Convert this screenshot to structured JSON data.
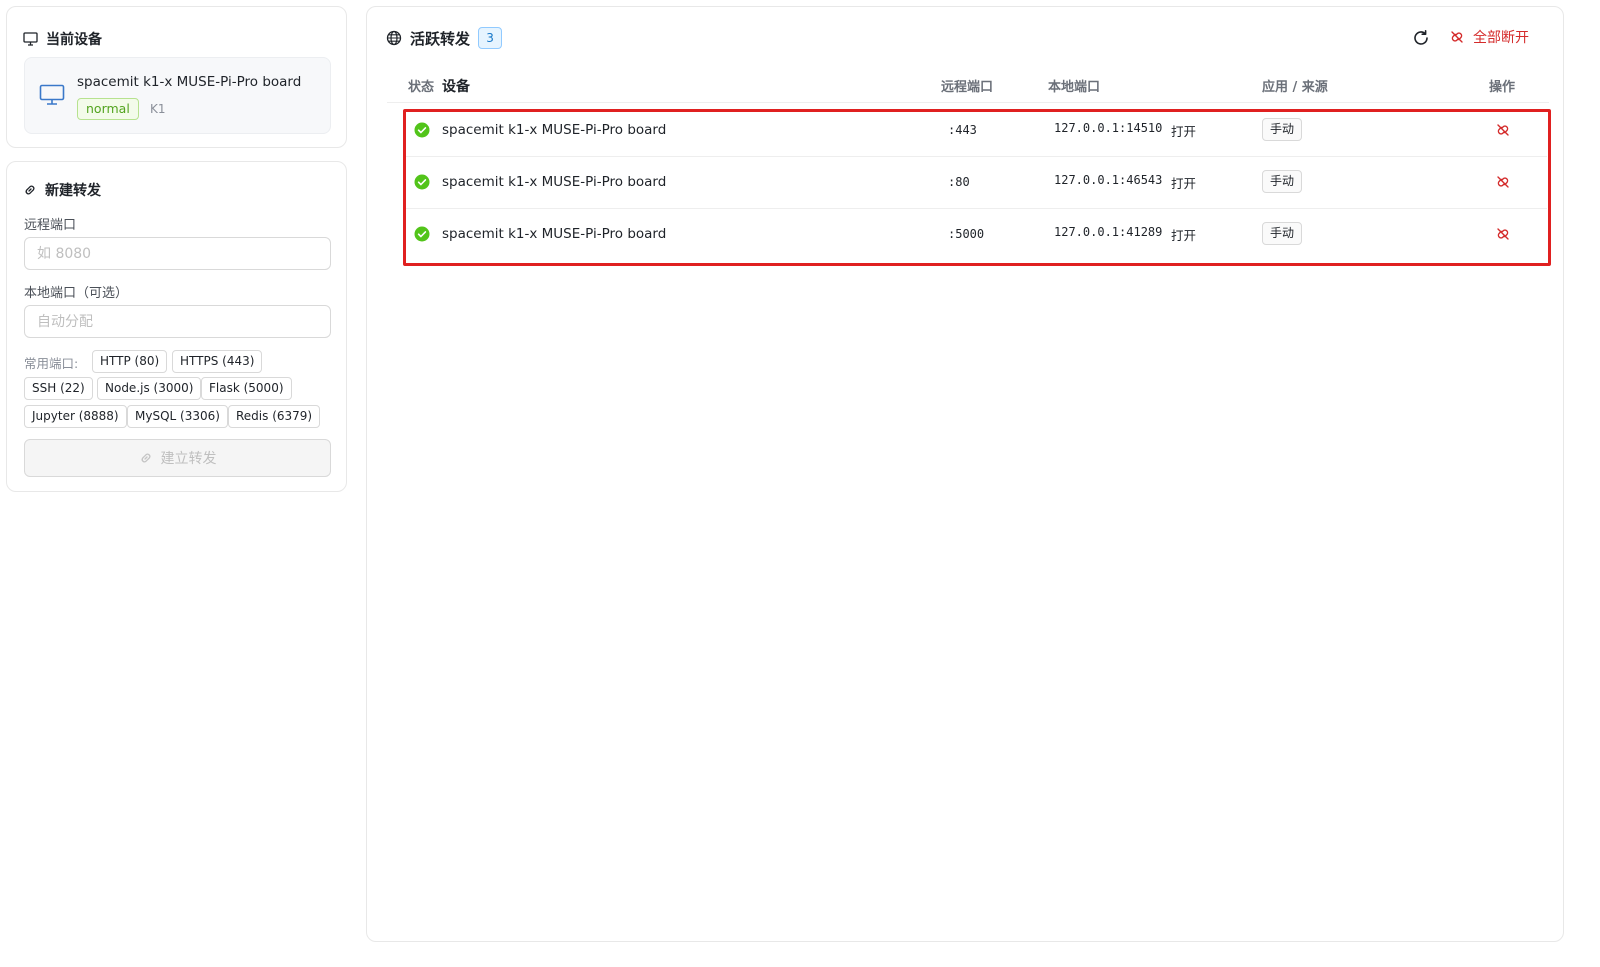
{
  "current_device": {
    "title": "当前设备",
    "icon": "monitor-icon",
    "name": "spacemit k1-x MUSE-Pi-Pro board",
    "status": "normal",
    "model": "K1"
  },
  "new_forward": {
    "title": "新建转发",
    "icon": "link-icon",
    "remote_port": {
      "label": "远程端口",
      "placeholder": "如 8080",
      "value": ""
    },
    "local_port": {
      "label": "本地端口（可选）",
      "placeholder": "自动分配",
      "value": ""
    },
    "common_ports_label": "常用端口:",
    "common_ports": [
      "HTTP (80)",
      "HTTPS (443)",
      "SSH (22)",
      "Node.js (3000)",
      "Flask (5000)",
      "Jupyter (8888)",
      "MySQL (3306)",
      "Redis (6379)"
    ],
    "submit_label": "建立转发"
  },
  "active_forwards": {
    "title": "活跃转发",
    "icon": "globe-icon",
    "count": "3",
    "disconnect_all_label": "全部断开",
    "columns": {
      "status": "状态",
      "device": "设备",
      "remote_port": "远程端口",
      "local_port": "本地端口",
      "app_source": "应用 / 来源",
      "actions": "操作"
    },
    "rows": [
      {
        "device": "spacemit k1-x MUSE-Pi-Pro board",
        "remote_port": ":443",
        "local_address": "127.0.0.1:14510",
        "open_label": "打开",
        "source": "手动"
      },
      {
        "device": "spacemit k1-x MUSE-Pi-Pro board",
        "remote_port": ":80",
        "local_address": "127.0.0.1:46543",
        "open_label": "打开",
        "source": "手动"
      },
      {
        "device": "spacemit k1-x MUSE-Pi-Pro board",
        "remote_port": ":5000",
        "local_address": "127.0.0.1:41289",
        "open_label": "打开",
        "source": "手动"
      }
    ]
  },
  "colors": {
    "accent": "#1677c8",
    "success": "#52c41a",
    "danger": "#d42b2b",
    "highlight": "#e02020"
  }
}
